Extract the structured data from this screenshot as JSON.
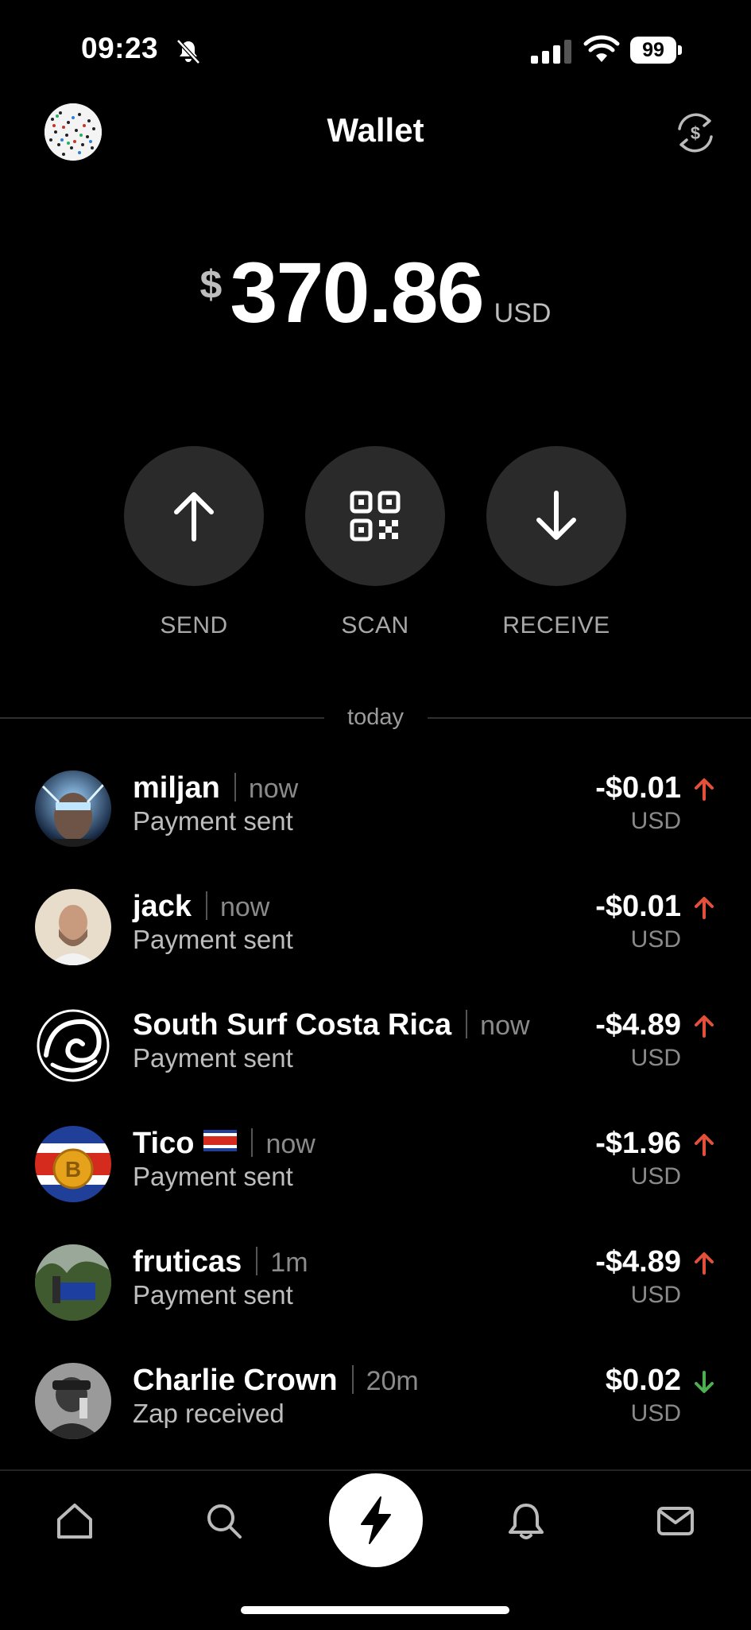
{
  "status_bar": {
    "time": "09:23",
    "battery": "99"
  },
  "header": {
    "title": "Wallet"
  },
  "balance": {
    "symbol": "$",
    "amount": "370.86",
    "unit": "USD"
  },
  "actions": [
    {
      "label": "SEND",
      "icon": "arrow-up-icon"
    },
    {
      "label": "SCAN",
      "icon": "qr-code-icon"
    },
    {
      "label": "RECEIVE",
      "icon": "arrow-down-icon"
    }
  ],
  "section": {
    "label": "today"
  },
  "transactions": [
    {
      "name": "miljan",
      "time": "now",
      "subtitle": "Payment sent",
      "amount": "-$0.01",
      "unit": "USD",
      "direction": "sent"
    },
    {
      "name": "jack",
      "time": "now",
      "subtitle": "Payment sent",
      "amount": "-$0.01",
      "unit": "USD",
      "direction": "sent"
    },
    {
      "name": "South Surf Costa Rica",
      "time": "now",
      "subtitle": "Payment sent",
      "amount": "-$4.89",
      "unit": "USD",
      "direction": "sent"
    },
    {
      "name": "Tico",
      "time": "now",
      "subtitle": "Payment sent",
      "amount": "-$1.96",
      "unit": "USD",
      "direction": "sent"
    },
    {
      "name": "fruticas",
      "time": "1m",
      "subtitle": "Payment sent",
      "amount": "-$4.89",
      "unit": "USD",
      "direction": "sent"
    },
    {
      "name": "Charlie Crown",
      "time": "20m",
      "subtitle": "Zap received",
      "amount": "$0.02",
      "unit": "USD",
      "direction": "received"
    }
  ],
  "colors": {
    "sent_arrow": "#e2503b",
    "received_arrow": "#4caf50",
    "background": "#000000",
    "action_bg": "#2a2a2a"
  },
  "tabbar": {
    "items": [
      "home-icon",
      "search-icon",
      "zap-icon",
      "bell-icon",
      "mail-icon"
    ]
  }
}
